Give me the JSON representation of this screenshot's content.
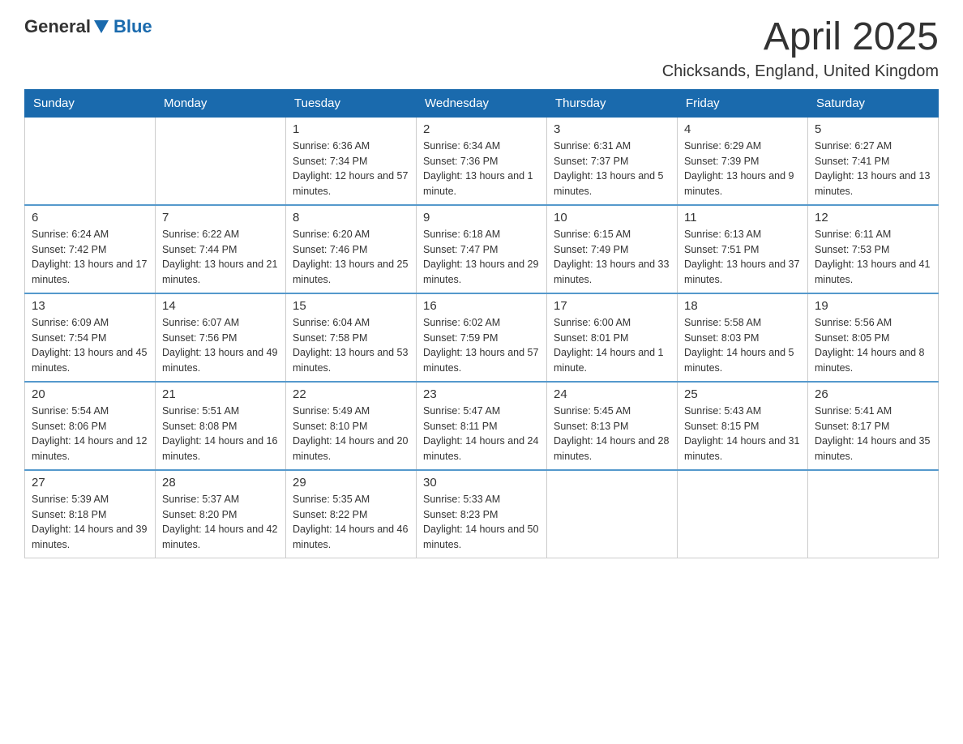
{
  "header": {
    "logo_general": "General",
    "logo_blue": "Blue",
    "month": "April 2025",
    "location": "Chicksands, England, United Kingdom"
  },
  "weekdays": [
    "Sunday",
    "Monday",
    "Tuesday",
    "Wednesday",
    "Thursday",
    "Friday",
    "Saturday"
  ],
  "weeks": [
    [
      {
        "day": "",
        "sunrise": "",
        "sunset": "",
        "daylight": ""
      },
      {
        "day": "",
        "sunrise": "",
        "sunset": "",
        "daylight": ""
      },
      {
        "day": "1",
        "sunrise": "Sunrise: 6:36 AM",
        "sunset": "Sunset: 7:34 PM",
        "daylight": "Daylight: 12 hours and 57 minutes."
      },
      {
        "day": "2",
        "sunrise": "Sunrise: 6:34 AM",
        "sunset": "Sunset: 7:36 PM",
        "daylight": "Daylight: 13 hours and 1 minute."
      },
      {
        "day": "3",
        "sunrise": "Sunrise: 6:31 AM",
        "sunset": "Sunset: 7:37 PM",
        "daylight": "Daylight: 13 hours and 5 minutes."
      },
      {
        "day": "4",
        "sunrise": "Sunrise: 6:29 AM",
        "sunset": "Sunset: 7:39 PM",
        "daylight": "Daylight: 13 hours and 9 minutes."
      },
      {
        "day": "5",
        "sunrise": "Sunrise: 6:27 AM",
        "sunset": "Sunset: 7:41 PM",
        "daylight": "Daylight: 13 hours and 13 minutes."
      }
    ],
    [
      {
        "day": "6",
        "sunrise": "Sunrise: 6:24 AM",
        "sunset": "Sunset: 7:42 PM",
        "daylight": "Daylight: 13 hours and 17 minutes."
      },
      {
        "day": "7",
        "sunrise": "Sunrise: 6:22 AM",
        "sunset": "Sunset: 7:44 PM",
        "daylight": "Daylight: 13 hours and 21 minutes."
      },
      {
        "day": "8",
        "sunrise": "Sunrise: 6:20 AM",
        "sunset": "Sunset: 7:46 PM",
        "daylight": "Daylight: 13 hours and 25 minutes."
      },
      {
        "day": "9",
        "sunrise": "Sunrise: 6:18 AM",
        "sunset": "Sunset: 7:47 PM",
        "daylight": "Daylight: 13 hours and 29 minutes."
      },
      {
        "day": "10",
        "sunrise": "Sunrise: 6:15 AM",
        "sunset": "Sunset: 7:49 PM",
        "daylight": "Daylight: 13 hours and 33 minutes."
      },
      {
        "day": "11",
        "sunrise": "Sunrise: 6:13 AM",
        "sunset": "Sunset: 7:51 PM",
        "daylight": "Daylight: 13 hours and 37 minutes."
      },
      {
        "day": "12",
        "sunrise": "Sunrise: 6:11 AM",
        "sunset": "Sunset: 7:53 PM",
        "daylight": "Daylight: 13 hours and 41 minutes."
      }
    ],
    [
      {
        "day": "13",
        "sunrise": "Sunrise: 6:09 AM",
        "sunset": "Sunset: 7:54 PM",
        "daylight": "Daylight: 13 hours and 45 minutes."
      },
      {
        "day": "14",
        "sunrise": "Sunrise: 6:07 AM",
        "sunset": "Sunset: 7:56 PM",
        "daylight": "Daylight: 13 hours and 49 minutes."
      },
      {
        "day": "15",
        "sunrise": "Sunrise: 6:04 AM",
        "sunset": "Sunset: 7:58 PM",
        "daylight": "Daylight: 13 hours and 53 minutes."
      },
      {
        "day": "16",
        "sunrise": "Sunrise: 6:02 AM",
        "sunset": "Sunset: 7:59 PM",
        "daylight": "Daylight: 13 hours and 57 minutes."
      },
      {
        "day": "17",
        "sunrise": "Sunrise: 6:00 AM",
        "sunset": "Sunset: 8:01 PM",
        "daylight": "Daylight: 14 hours and 1 minute."
      },
      {
        "day": "18",
        "sunrise": "Sunrise: 5:58 AM",
        "sunset": "Sunset: 8:03 PM",
        "daylight": "Daylight: 14 hours and 5 minutes."
      },
      {
        "day": "19",
        "sunrise": "Sunrise: 5:56 AM",
        "sunset": "Sunset: 8:05 PM",
        "daylight": "Daylight: 14 hours and 8 minutes."
      }
    ],
    [
      {
        "day": "20",
        "sunrise": "Sunrise: 5:54 AM",
        "sunset": "Sunset: 8:06 PM",
        "daylight": "Daylight: 14 hours and 12 minutes."
      },
      {
        "day": "21",
        "sunrise": "Sunrise: 5:51 AM",
        "sunset": "Sunset: 8:08 PM",
        "daylight": "Daylight: 14 hours and 16 minutes."
      },
      {
        "day": "22",
        "sunrise": "Sunrise: 5:49 AM",
        "sunset": "Sunset: 8:10 PM",
        "daylight": "Daylight: 14 hours and 20 minutes."
      },
      {
        "day": "23",
        "sunrise": "Sunrise: 5:47 AM",
        "sunset": "Sunset: 8:11 PM",
        "daylight": "Daylight: 14 hours and 24 minutes."
      },
      {
        "day": "24",
        "sunrise": "Sunrise: 5:45 AM",
        "sunset": "Sunset: 8:13 PM",
        "daylight": "Daylight: 14 hours and 28 minutes."
      },
      {
        "day": "25",
        "sunrise": "Sunrise: 5:43 AM",
        "sunset": "Sunset: 8:15 PM",
        "daylight": "Daylight: 14 hours and 31 minutes."
      },
      {
        "day": "26",
        "sunrise": "Sunrise: 5:41 AM",
        "sunset": "Sunset: 8:17 PM",
        "daylight": "Daylight: 14 hours and 35 minutes."
      }
    ],
    [
      {
        "day": "27",
        "sunrise": "Sunrise: 5:39 AM",
        "sunset": "Sunset: 8:18 PM",
        "daylight": "Daylight: 14 hours and 39 minutes."
      },
      {
        "day": "28",
        "sunrise": "Sunrise: 5:37 AM",
        "sunset": "Sunset: 8:20 PM",
        "daylight": "Daylight: 14 hours and 42 minutes."
      },
      {
        "day": "29",
        "sunrise": "Sunrise: 5:35 AM",
        "sunset": "Sunset: 8:22 PM",
        "daylight": "Daylight: 14 hours and 46 minutes."
      },
      {
        "day": "30",
        "sunrise": "Sunrise: 5:33 AM",
        "sunset": "Sunset: 8:23 PM",
        "daylight": "Daylight: 14 hours and 50 minutes."
      },
      {
        "day": "",
        "sunrise": "",
        "sunset": "",
        "daylight": ""
      },
      {
        "day": "",
        "sunrise": "",
        "sunset": "",
        "daylight": ""
      },
      {
        "day": "",
        "sunrise": "",
        "sunset": "",
        "daylight": ""
      }
    ]
  ]
}
